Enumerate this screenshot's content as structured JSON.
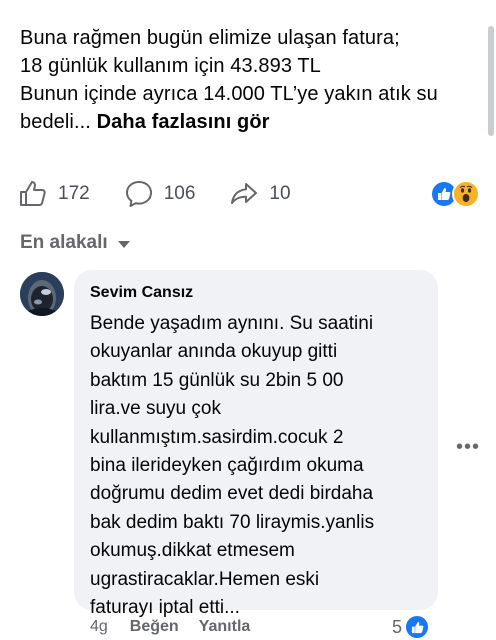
{
  "post": {
    "lines": [
      "Buna rağmen bugün elimize ulaşan fatura;",
      "18 günlük kullanım için 43.893 TL",
      "Bunun içinde ayrıca 14.000 TL’ye yakın atık su",
      "bedeli... "
    ],
    "see_more": "Daha fazlasını gör"
  },
  "actions": {
    "like_count": "172",
    "comment_count": "106",
    "share_count": "10"
  },
  "reactions": [
    "like-icon",
    "wow-icon"
  ],
  "sort": {
    "label": "En alakalı"
  },
  "comment": {
    "author": "Sevim Cansız",
    "lines": [
      "Bende yaşadım aynını. Su saatini",
      "okuyanlar anında okuyup gitti",
      "baktım 15 günlük su 2bin 5 00",
      "lira.ve suyu çok",
      "kullanmıştım.sasirdim.cocuk 2",
      "bina ilerideyken çağırdım okuma",
      "doğrumu dedim evet dedi birdaha",
      "bak dedim baktı 70 liraymis.yanlis",
      "okumuş.dikkat etmesem",
      "ugrastiracaklar.Hemen eski",
      "faturayı iptal etti..."
    ],
    "time": "4g",
    "like_label": "Beğen",
    "reply_label": "Yanıtla",
    "reaction_count": "5"
  },
  "colors": {
    "accent": "#1877f2",
    "secondary_text": "#65676b",
    "bubble": "#f0f2f5",
    "wow": "#f7b125"
  }
}
